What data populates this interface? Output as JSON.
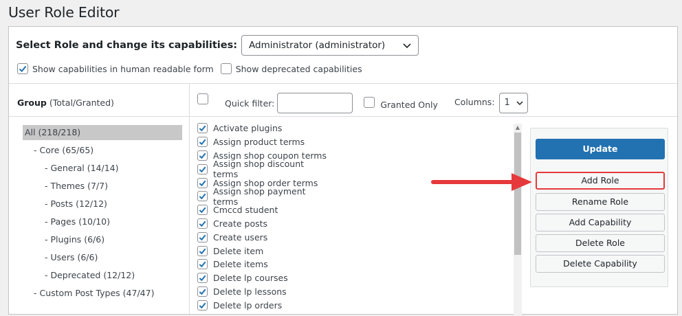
{
  "page": {
    "title": "User Role Editor"
  },
  "role_select": {
    "label": "Select Role and change its capabilities:",
    "value": "Administrator (administrator)"
  },
  "options": {
    "human_readable": {
      "label": "Show capabilities in human readable form",
      "checked": true
    },
    "deprecated": {
      "label": "Show deprecated capabilities",
      "checked": false
    }
  },
  "groups": {
    "header_bold": "Group",
    "header_rest": "(Total/Granted)",
    "items": [
      {
        "label": "All (218/218)",
        "level": 0,
        "selected": true
      },
      {
        "label": "- Core (65/65)",
        "level": 1
      },
      {
        "label": "- General (14/14)",
        "level": 2
      },
      {
        "label": "- Themes (7/7)",
        "level": 2
      },
      {
        "label": "- Posts (12/12)",
        "level": 2
      },
      {
        "label": "- Pages (10/10)",
        "level": 2
      },
      {
        "label": "- Plugins (6/6)",
        "level": 2
      },
      {
        "label": "- Users (6/6)",
        "level": 2
      },
      {
        "label": "- Deprecated (12/12)",
        "level": 2
      },
      {
        "label": "- Custom Post Types (47/47)",
        "level": 1
      }
    ]
  },
  "filter": {
    "quick_filter_label": "Quick filter:",
    "quick_filter_value": "",
    "granted_only_label": "Granted Only",
    "columns_label": "Columns:",
    "columns_value": "1"
  },
  "capabilities": [
    "Activate plugins",
    "Assign product terms",
    "Assign shop coupon terms",
    "Assign shop discount terms",
    "Assign shop order terms",
    "Assign shop payment terms",
    "Cmccd student",
    "Create posts",
    "Create users",
    "Delete item",
    "Delete items",
    "Delete lp courses",
    "Delete lp lessons",
    "Delete lp orders"
  ],
  "actions": {
    "update": "Update",
    "add_role": "Add Role",
    "rename_role": "Rename Role",
    "add_capability": "Add Capability",
    "delete_role": "Delete Role",
    "delete_capability": "Delete Capability"
  },
  "colors": {
    "primary": "#2271b1",
    "highlight": "#e5393b",
    "checkbox": "#2271b1"
  }
}
